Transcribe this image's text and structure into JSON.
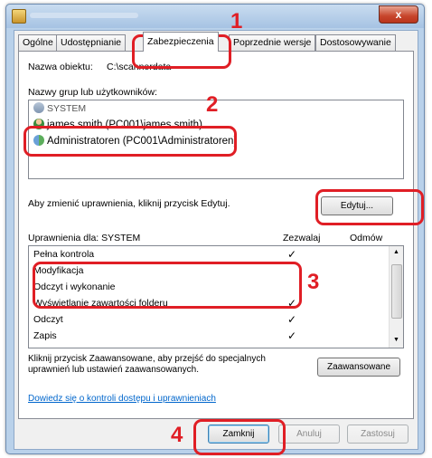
{
  "window": {
    "close_symbol": "x"
  },
  "tabs": [
    "Ogólne",
    "Udostępnianie",
    "Zabezpieczenia",
    "Poprzednie wersje",
    "Dostosowywanie"
  ],
  "object_name": {
    "label": "Nazwa obiektu:",
    "value": "C:\\scannerdata"
  },
  "groups": {
    "label": "Nazwy grup lub użytkowników:",
    "items": [
      "SYSTEM",
      "james.smith (PC001\\james.smith)",
      "Administratoren (PC001\\Administratoren)"
    ]
  },
  "change_hint": "Aby zmienić uprawnienia, kliknij przycisk Edytuj.",
  "edit_button": "Edytuj...",
  "permissions": {
    "header": "Uprawnienia dla: SYSTEM",
    "allow_header": "Zezwalaj",
    "deny_header": "Odmów",
    "rows": [
      {
        "name": "Pełna kontrola",
        "allow": "✓"
      },
      {
        "name": "Modyfikacja",
        "allow": ""
      },
      {
        "name": "Odczyt i wykonanie",
        "allow": ""
      },
      {
        "name": "Wyświetlanie zawartości folderu",
        "allow": "✓"
      },
      {
        "name": "Odczyt",
        "allow": "✓"
      },
      {
        "name": "Zapis",
        "allow": "✓"
      }
    ]
  },
  "advanced_hint_line1": "Kliknij przycisk Zaawansowane, aby przejść do specjalnych",
  "advanced_hint_line2": "uprawnień lub ustawień zaawansowanych.",
  "advanced_button": "Zaawansowane",
  "learn_link": "Dowiedz się o kontroli dostępu i uprawnieniach",
  "footer_buttons": {
    "close": "Zamknij",
    "cancel": "Anuluj",
    "apply": "Zastosuj"
  },
  "callouts": [
    "1",
    "2",
    "3",
    "4"
  ],
  "colors": {
    "callout": "#e01e25",
    "link": "#0066cc"
  }
}
